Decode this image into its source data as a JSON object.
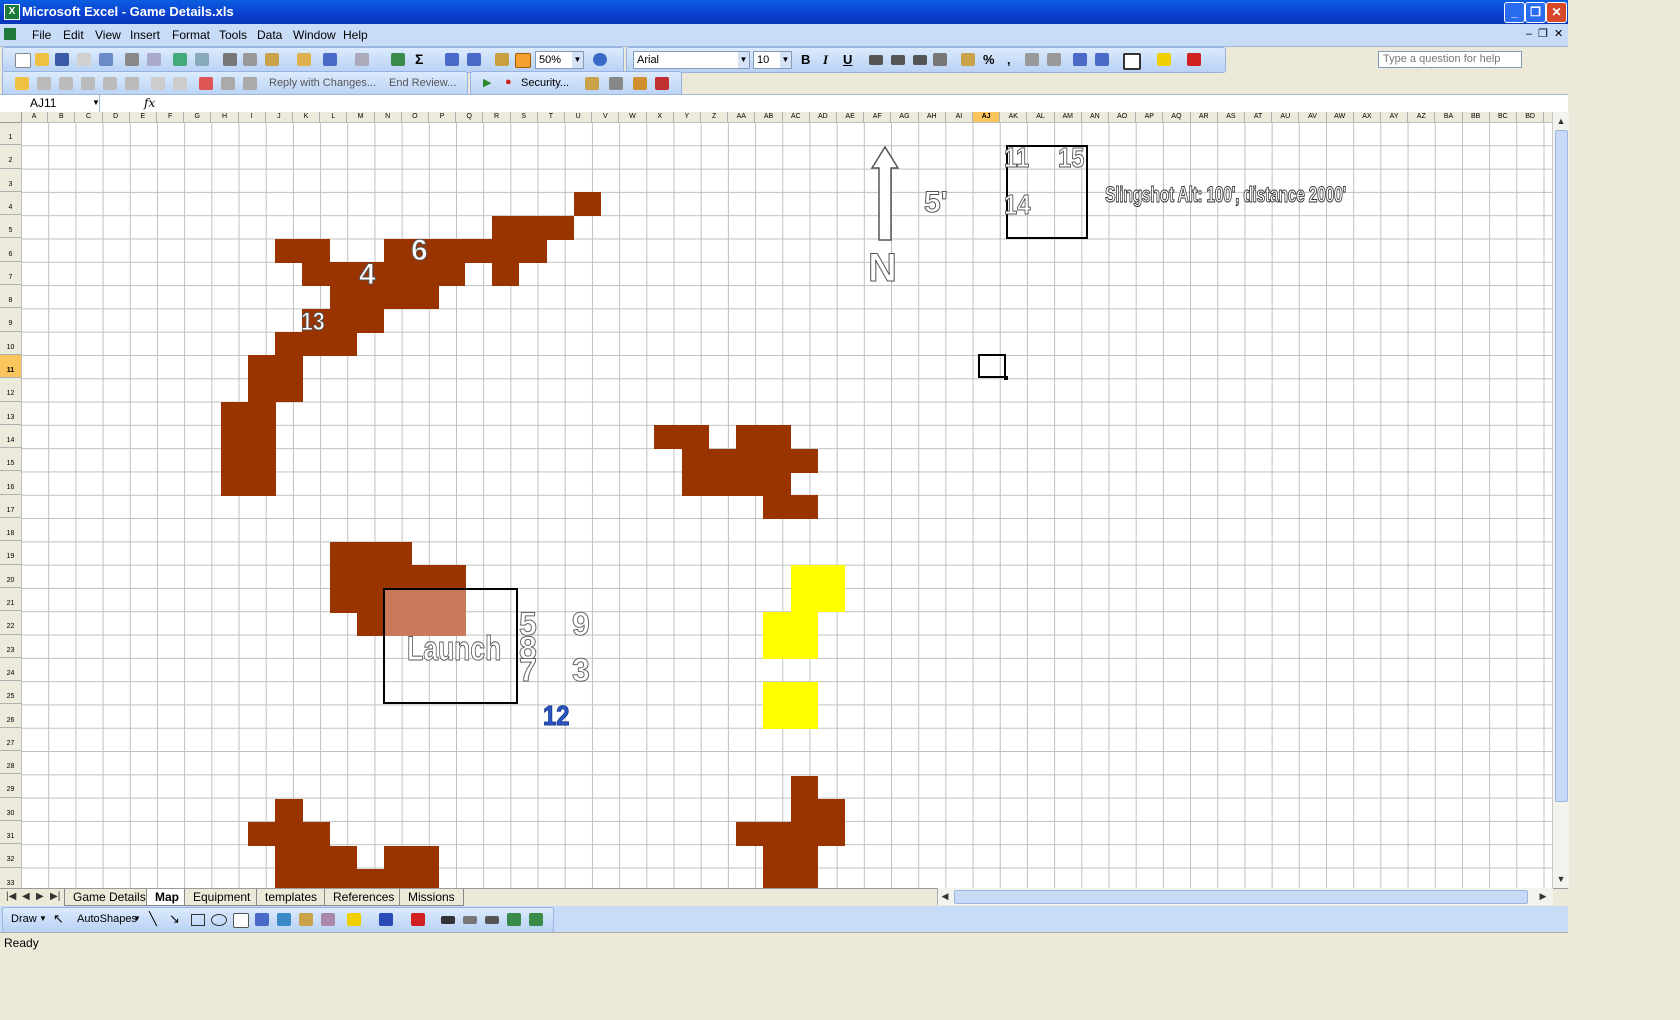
{
  "window": {
    "title": "Microsoft Excel - Game Details.xls",
    "controls": [
      "_",
      "❐",
      "✕"
    ]
  },
  "menu": {
    "items": [
      "File",
      "Edit",
      "View",
      "Insert",
      "Format",
      "Tools",
      "Data",
      "Window",
      "Help"
    ],
    "help_placeholder": "Type a question for help"
  },
  "toolbar": {
    "zoom": "50%",
    "font": "Arial",
    "font_size": "10",
    "bold": "B",
    "italic": "I",
    "underline": "U",
    "percent": "%",
    "comma": ",",
    "reply_text": "Reply with Changes...",
    "end_review": "End Review...",
    "security": "Security..."
  },
  "formula_bar": {
    "name_box": "AJ11",
    "fx": "fx",
    "value": ""
  },
  "sheet": {
    "columns": [
      "A",
      "B",
      "C",
      "D",
      "E",
      "F",
      "G",
      "H",
      "I",
      "J",
      "K",
      "L",
      "M",
      "N",
      "O",
      "P",
      "Q",
      "R",
      "S",
      "T",
      "U",
      "V",
      "W",
      "X",
      "Y",
      "Z",
      "AA",
      "AB",
      "AC",
      "AD",
      "AE",
      "AF",
      "AG",
      "AH",
      "AI",
      "AJ",
      "AK",
      "AL",
      "AM",
      "AN",
      "AO",
      "AP",
      "AQ",
      "AR",
      "AS",
      "AT",
      "AU",
      "AV",
      "AW",
      "AX",
      "AY",
      "AZ",
      "BA",
      "BB",
      "BC",
      "BD"
    ],
    "rows": [
      "1",
      "2",
      "3",
      "4",
      "5",
      "6",
      "7",
      "8",
      "9",
      "10",
      "11",
      "12",
      "13",
      "14",
      "15",
      "16",
      "17",
      "18",
      "19",
      "20",
      "21",
      "22",
      "23",
      "24",
      "25",
      "26",
      "27",
      "28",
      "29",
      "30",
      "31",
      "32",
      "33"
    ],
    "selected_column": "AJ",
    "selected_row": "11",
    "colors": {
      "terrain": "#993300",
      "yellow": "#ffff00",
      "launch_fill": "#c97a5a"
    }
  },
  "map_labels": {
    "n4": "4",
    "n6": "6",
    "n13": "13",
    "n5": "5",
    "n9": "9",
    "n8": "8",
    "n7": "7",
    "n3": "3",
    "n12": "12",
    "n11": "11",
    "n15": "15",
    "n14": "14",
    "launch": "Launch",
    "north": "N",
    "five_ft": "5'",
    "slingshot": "Slingshot Alt: 100', distance 2000'"
  },
  "tabs": [
    "Game Details",
    "Map",
    "Equipment",
    "templates",
    "References",
    "Missions"
  ],
  "active_tab": "Map",
  "draw_toolbar": {
    "draw": "Draw",
    "autoshapes": "AutoShapes"
  },
  "status": "Ready"
}
